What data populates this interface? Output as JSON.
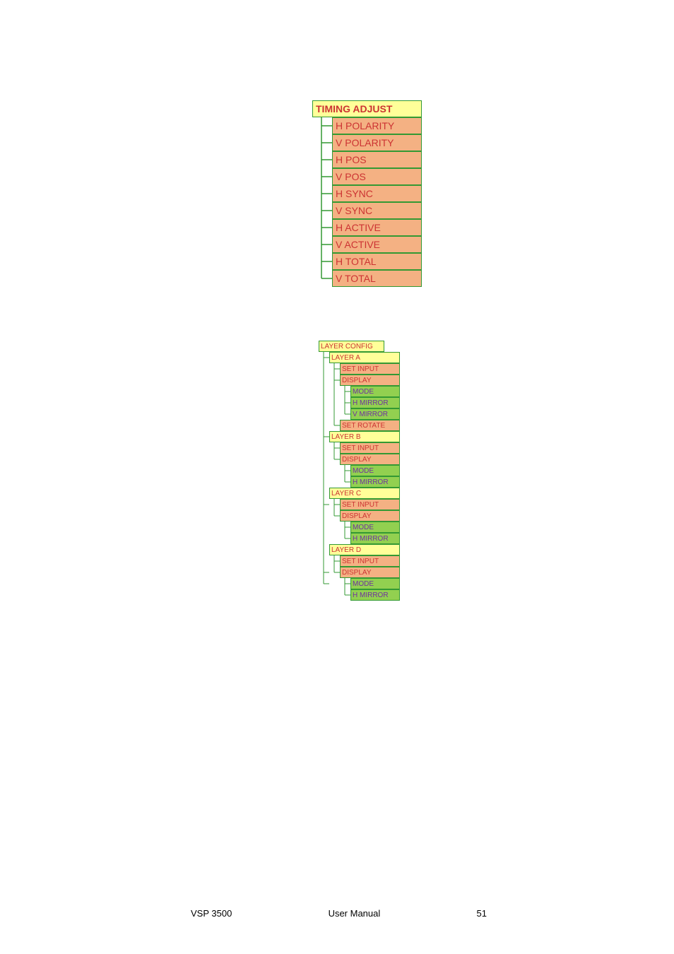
{
  "timing_adjust": {
    "title": "TIMING ADJUST",
    "items": [
      "H POLARITY",
      "V POLARITY",
      "H POS",
      "V POS",
      "H SYNC",
      "V SYNC",
      "H ACTIVE",
      "V ACTIVE",
      "H TOTAL",
      "V TOTAL"
    ]
  },
  "layer_config": {
    "title": "LAYER CONFIG",
    "layers": [
      {
        "name": "LAYER A",
        "set_input": "SET INPUT",
        "display": {
          "label": "DISPLAY",
          "leaves": [
            "MODE",
            "H MIRROR",
            "V MIRROR"
          ]
        },
        "extra": "SET ROTATE"
      },
      {
        "name": "LAYER B",
        "set_input": "SET INPUT",
        "display": {
          "label": "DISPLAY",
          "leaves": [
            "MODE",
            "H MIRROR"
          ]
        }
      },
      {
        "name": "LAYER C",
        "set_input": "SET INPUT",
        "display": {
          "label": "DISPLAY",
          "leaves": [
            "MODE",
            "H MIRROR"
          ]
        }
      },
      {
        "name": "LAYER D",
        "set_input": "SET INPUT",
        "display": {
          "label": "DISPLAY",
          "leaves": [
            "MODE",
            "H MIRROR"
          ]
        }
      }
    ]
  },
  "footer": {
    "product": "VSP 3500",
    "doc": "User Manual",
    "page": "51"
  }
}
